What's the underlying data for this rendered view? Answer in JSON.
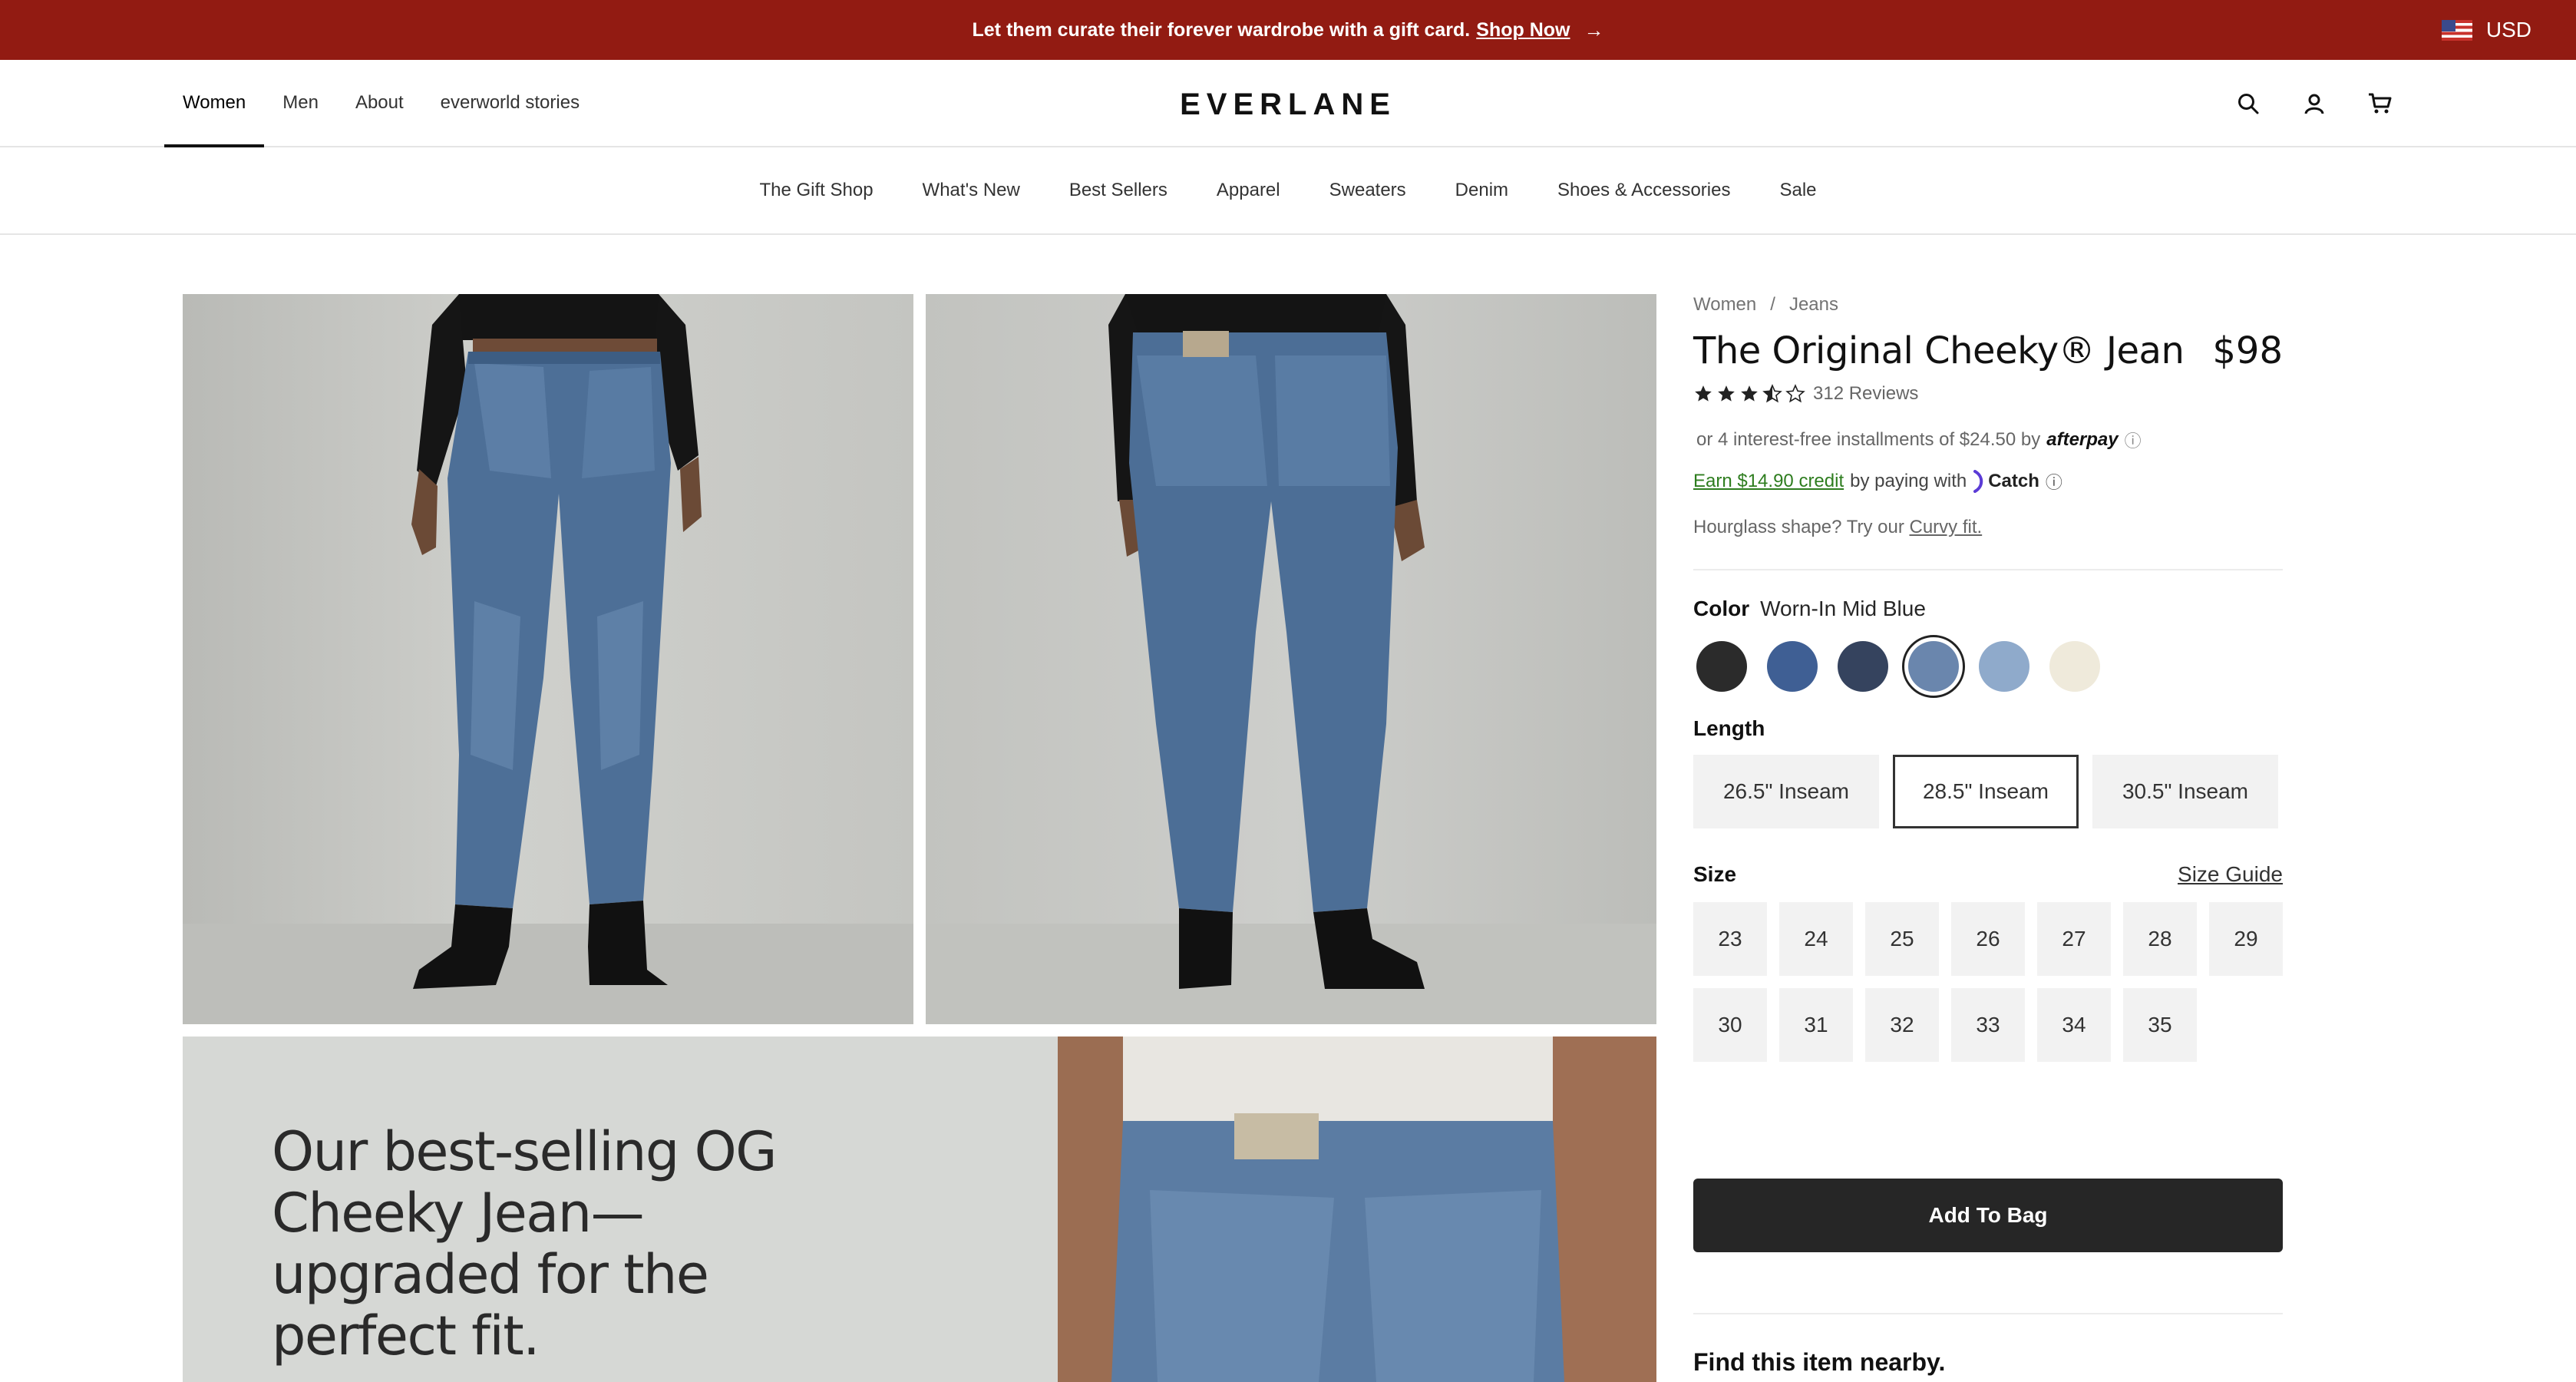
{
  "promo_bar": {
    "message": "Let them curate their forever wardrobe with a gift card.",
    "link": "Shop Now",
    "currency": "USD"
  },
  "top_nav": {
    "tabs": [
      {
        "label": "Women",
        "active": true
      },
      {
        "label": "Men"
      },
      {
        "label": "About"
      },
      {
        "label": "everworld stories"
      }
    ],
    "logo": "EVERLANE",
    "icons": [
      "search-icon",
      "account-icon",
      "cart-icon"
    ]
  },
  "category_nav": {
    "items": [
      "The Gift Shop",
      "What's New",
      "Best Sellers",
      "Apparel",
      "Sweaters",
      "Denim",
      "Shoes & Accessories",
      "Sale"
    ]
  },
  "gallery": {
    "tile_headline": "Our best-selling OG Cheeky Jean—upgraded for the perfect fit."
  },
  "product": {
    "breadcrumb": [
      "Women",
      "/",
      "Jeans"
    ],
    "title": "The Original Cheeky® Jean",
    "price": "$98",
    "rating_stars": 3.5,
    "reviews": "312 Reviews",
    "afterpay_text": "or 4 interest-free installments of $24.50 by",
    "afterpay_brand": "afterpay",
    "catch_earn": "Earn $14.90 credit",
    "catch_text": "by paying with",
    "catch_brand": "Catch",
    "hourglass_text": "Hourglass shape? Try our",
    "hourglass_link": "Curvy fit.",
    "color_label": "Color",
    "color_value": "Worn-In Mid Blue",
    "swatches": [
      "#2b2b2b",
      "#3f5f94",
      "#35435e",
      "#6a86ad",
      "#8faacb",
      "#efeadb"
    ],
    "selected_swatch": 3,
    "length_label": "Length",
    "lengths": [
      "26.5\" Inseam",
      "28.5\" Inseam",
      "30.5\" Inseam"
    ],
    "selected_length": 1,
    "size_label": "Size",
    "size_guide": "Size Guide",
    "sizes": [
      "23",
      "24",
      "25",
      "26",
      "27",
      "28",
      "29",
      "30",
      "31",
      "32",
      "33",
      "34",
      "35"
    ],
    "add_to_bag": "Add To Bag",
    "nearby": "Find this item nearby."
  }
}
